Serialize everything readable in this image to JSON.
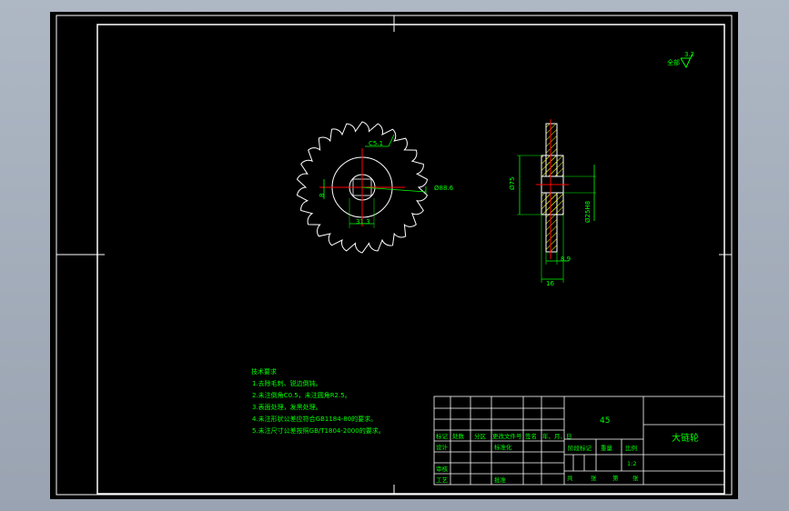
{
  "drawing": {
    "surface_symbol": {
      "prefix": "全部",
      "value": "3.2"
    },
    "front_view": {
      "dims": {
        "chamfer": "C5.1",
        "outer_dia": "Ø88.6",
        "hub_dia": "31.3",
        "keyway": "8"
      }
    },
    "side_view": {
      "dims": {
        "hub": "Ø75",
        "bore": "Ø25H8",
        "tooth_width": "8.9",
        "total_width": "16"
      }
    },
    "tech_requirements": {
      "title": "技术要求",
      "items": [
        "1.去除毛刺、锐边倒钝。",
        "2.未注倒角C0.5，未注圆角R2.5。",
        "3.表面处理，发黑处理。",
        "4.未注形状公差应符合GB1184-80的要求。",
        "5.未注尺寸公差按照GB/T1804-2000的要求。"
      ]
    },
    "title_block": {
      "material": "45",
      "part_name": "大链轮",
      "headers": [
        "标记",
        "处数",
        "分区",
        "更改文件号",
        "签名",
        "年、月、日"
      ],
      "roles": {
        "design": "设计",
        "standardize": "标准化",
        "review": "审核",
        "process": "工艺",
        "approve": "批准"
      },
      "stage_mark": "阶段标记",
      "weight": "重量",
      "ratio": "比例",
      "scale": "1:2",
      "sheet_footer": [
        "共",
        "张",
        "第",
        "张"
      ]
    }
  },
  "colors": {
    "background": "#000000",
    "frame": "#ffffff",
    "text": "#00ff00",
    "centerline": "#ff0000",
    "hatch": "#ffff00"
  }
}
